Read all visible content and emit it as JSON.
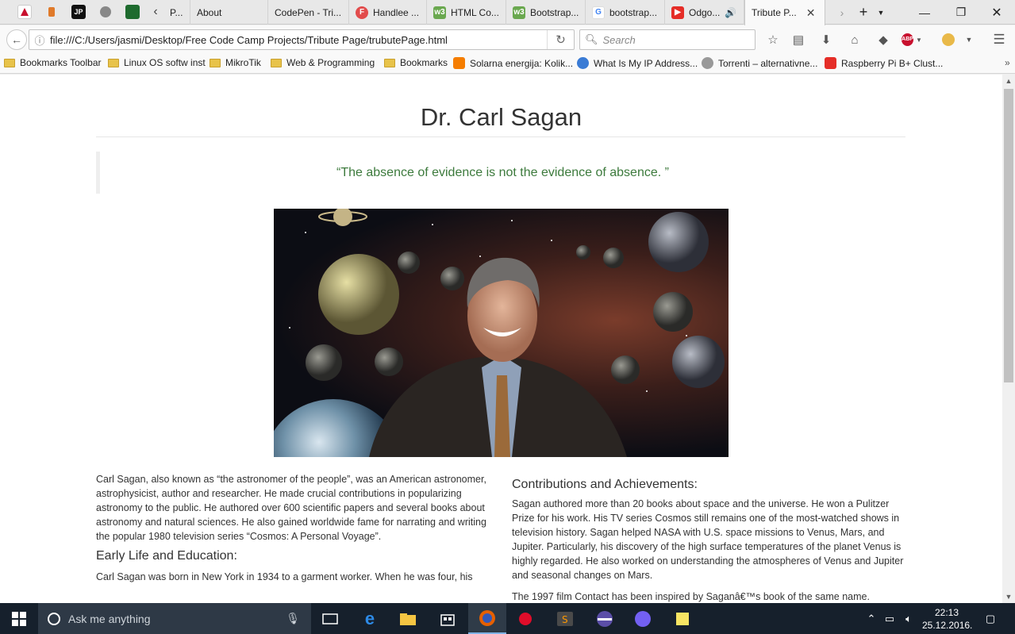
{
  "browser": {
    "tabs": [
      {
        "label": "P...",
        "favicon": "page-icon"
      },
      {
        "label": "About",
        "favicon": ""
      },
      {
        "label": "CodePen - Tri...",
        "favicon": ""
      },
      {
        "label": "Handlee ...",
        "favicon": "font-icon"
      },
      {
        "label": "HTML Co...",
        "favicon": "w3-icon"
      },
      {
        "label": "Bootstrap...",
        "favicon": "w3-icon"
      },
      {
        "label": "bootstrap...",
        "favicon": "google-icon"
      },
      {
        "label": "Odgo...",
        "favicon": "youtube-icon"
      },
      {
        "label": "Tribute P...",
        "favicon": "",
        "active": true
      }
    ],
    "url": "file:///C:/Users/jasmi/Desktop/Free Code Camp Projects/Tribute Page/trubutePage.html",
    "search_placeholder": "Search",
    "bookmarks": [
      {
        "label": "Bookmarks Toolbar",
        "type": "folder"
      },
      {
        "label": "Linux OS softw inst",
        "type": "folder"
      },
      {
        "label": "MikroTik",
        "type": "folder"
      },
      {
        "label": "Web & Programming",
        "type": "folder"
      },
      {
        "label": "Bookmarks",
        "type": "folder"
      },
      {
        "label": "Solarna energija: Kolik...",
        "type": "link"
      },
      {
        "label": "What Is My IP Address...",
        "type": "link"
      },
      {
        "label": "Torrenti – alternativne...",
        "type": "link"
      },
      {
        "label": "Raspberry Pi B+ Clust...",
        "type": "link"
      }
    ],
    "colors": {
      "quote": "#3c7a3c",
      "accent": "#0078d7"
    }
  },
  "page": {
    "title": "Dr. Carl Sagan",
    "quote": "“The absence of evidence is not the evidence of absence. ”",
    "intro": "Carl Sagan, also known as “the astronomer of the people”, was an American astronomer, astrophysicist, author and researcher. He made crucial contributions in popularizing astronomy to the public. He authored over 600 scientific papers and several books about astronomy and natural sciences. He also gained worldwide fame for narrating and writing the popular 1980 television series “Cosmos: A Personal Voyage”.",
    "early_heading": "Early Life and Education:",
    "early_text": "Carl Sagan was born in New York in 1934 to a garment worker. When he was four, his",
    "contrib_heading": "Contributions and Achievements:",
    "contrib_text": "Sagan authored more than 20 books about space and the universe. He won a Pulitzer Prize for his work. His TV series Cosmos still remains one of the most-watched shows in television history. Sagan helped NASA with U.S. space missions to Venus, Mars, and Jupiter. Particularly, his discovery of the high surface temperatures of the planet Venus is highly regarded. He also worked on understanding the atmospheres of Venus and Jupiter and seasonal changes on Mars.",
    "film_text": "The 1997 film Contact has been inspired by Saganâ€™s book of the same name."
  },
  "taskbar": {
    "search_placeholder": "Ask me anything",
    "time": "22:13",
    "date": "25.12.2016."
  }
}
